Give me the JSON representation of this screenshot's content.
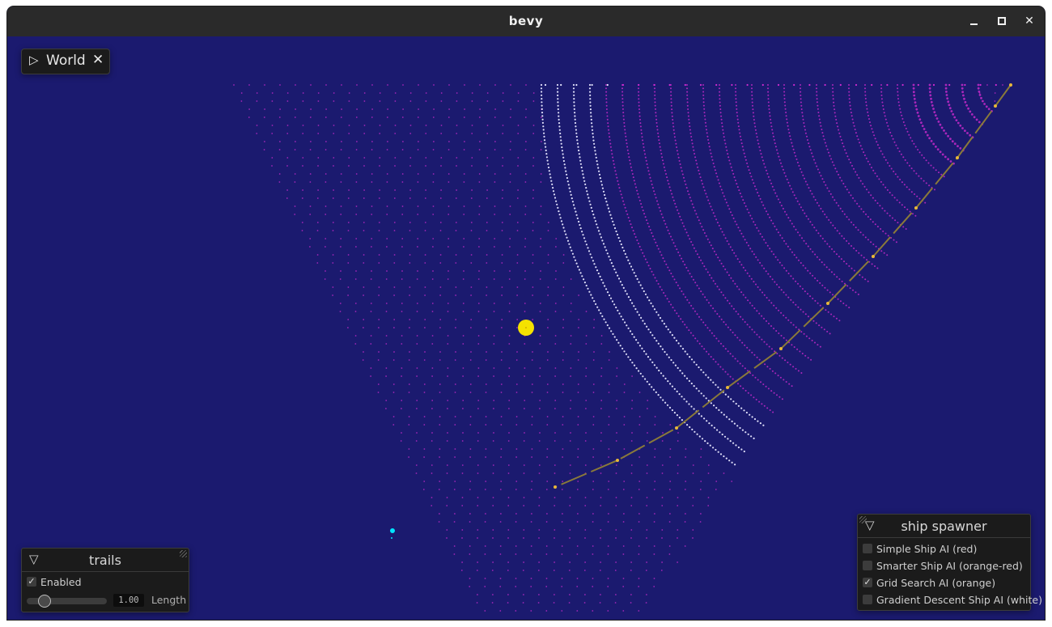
{
  "window": {
    "title": "bevy",
    "controls": {
      "minimize_icon": "minimize-icon",
      "maximize_icon": "maximize-icon",
      "close_icon": "close-icon",
      "close_glyph": "✕"
    }
  },
  "world_button": {
    "label": "World",
    "expand_glyph": "▷",
    "close_glyph": "✕"
  },
  "trails_panel": {
    "title": "trails",
    "collapse_glyph": "▽",
    "enabled_label": "Enabled",
    "enabled_checked": "✓",
    "length_value": "1.00",
    "length_label": "Length"
  },
  "ship_spawner": {
    "title": "ship spawner",
    "collapse_glyph": "▽",
    "options": [
      {
        "label": "Simple Ship AI (red)",
        "checked": ""
      },
      {
        "label": "Smarter Ship AI (orange-red)",
        "checked": ""
      },
      {
        "label": "Grid Search AI (orange)",
        "checked": "✓"
      },
      {
        "label": "Gradient Descent Ship AI (white)",
        "checked": ""
      }
    ]
  },
  "colors": {
    "background": "#1b1a6f",
    "sun": "#f5e200",
    "ship": "#00e5ff",
    "trajectory": "#8a7a3a",
    "waypoint": "#e8b83a",
    "magenta_dots": "#d02bd0",
    "white_dots": "#e8e8ff"
  }
}
